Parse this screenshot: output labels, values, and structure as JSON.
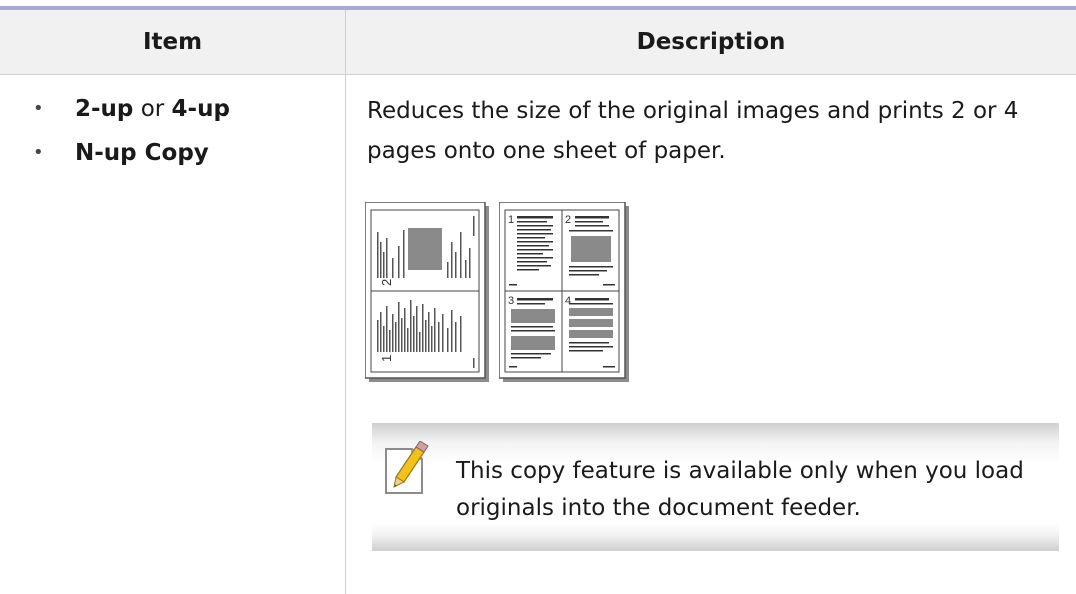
{
  "table": {
    "headers": {
      "item": "Item",
      "description": "Description"
    },
    "items": [
      {
        "bullet": "•",
        "part1": "2-up",
        "connector": " or ",
        "part2": "4-up"
      },
      {
        "bullet": "•",
        "part1": "N-up Copy"
      }
    ],
    "description": "Reduces the size of the original images and prints 2 or 4 pages onto one sheet of paper.",
    "illustration": {
      "two_up_page_numbers": [
        "2",
        "1"
      ],
      "four_up_page_numbers": [
        "1",
        "2",
        "3",
        "4"
      ]
    },
    "note": {
      "icon": "note-pencil-icon",
      "text": "This copy feature is available only when you load originals into the document feeder."
    }
  },
  "colors": {
    "top_rule": "#a9a9d4",
    "header_bg": "#f1f1f1",
    "divider": "#cfcfcf"
  }
}
